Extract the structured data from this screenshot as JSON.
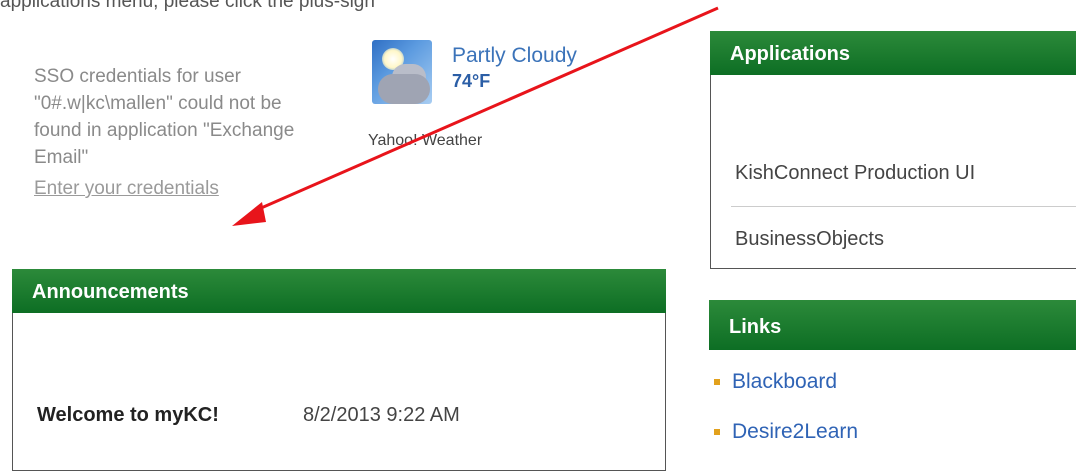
{
  "page": {
    "top_line": "applications menu, please click the plus-sign"
  },
  "sso": {
    "message": "SSO credentials for user \"0#.w|kc\\mallen\" could not be found in application \"Exchange Email\"",
    "link": "Enter your credentials"
  },
  "weather": {
    "condition": "Partly Cloudy",
    "temperature": "74°F",
    "source": "Yahoo! Weather",
    "icon": "partly-cloudy-icon"
  },
  "announcements": {
    "title": "Announcements",
    "items": [
      {
        "title": "Welcome to myKC!",
        "date": "8/2/2013 9:22 AM"
      }
    ]
  },
  "applications": {
    "title": "Applications",
    "items": [
      "KishConnect Production UI",
      "BusinessObjects"
    ]
  },
  "links": {
    "title": "Links",
    "items": [
      "Blackboard",
      "Desire2Learn"
    ]
  },
  "colors": {
    "header_green": "#0d6e24",
    "link_blue": "#2f63b5",
    "bullet_orange": "#e2a11d",
    "annotation_arrow": "#e8141b"
  }
}
